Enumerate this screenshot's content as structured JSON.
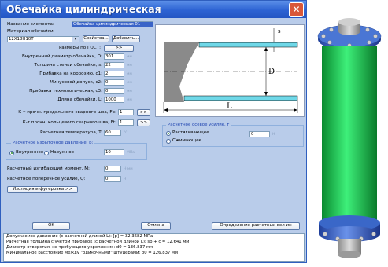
{
  "window": {
    "title": "Обечайка цилиндрическая",
    "close_glyph": "✕"
  },
  "name": {
    "label": "Название элемента:",
    "value": "Обечайка цилиндрическая 01"
  },
  "material": {
    "label": "Материал обечайки:",
    "value": "12Х18Н10Т",
    "props_btn": "Свойства...",
    "add_btn": "Добавить..."
  },
  "gost": {
    "label": "Размеры по ГОСТ:",
    "btn": ">>"
  },
  "fields": [
    {
      "label": "Внутренний диаметр обечайки, D:",
      "value": "301",
      "unit": "мм"
    },
    {
      "label": "Толщина стенки обечайки, s:",
      "value": "22",
      "unit": "мм"
    },
    {
      "label": "Прибавка на коррозию, c1:",
      "value": "2",
      "unit": "мм"
    },
    {
      "label": "Минусовой допуск, c2:",
      "value": "0",
      "unit": "мм"
    },
    {
      "label": "Прибавка технологическая, c3:",
      "value": "0",
      "unit": "мм"
    },
    {
      "label": "Длина обечайки, L:",
      "value": "1000",
      "unit": "мм"
    }
  ],
  "weld_long": {
    "label": "К-т прочн. продольного сварного шва, Fp:",
    "value": "1",
    "btn": ">>"
  },
  "weld_circ": {
    "label": "К-т прочн. кольцевого сварного шва, Ft:",
    "value": "1",
    "btn": ">>"
  },
  "temperature": {
    "label": "Расчетная температура, T:",
    "value": "60",
    "unit": "°C"
  },
  "pressure": {
    "group_label": "Расчетное избыточное давление, p:",
    "inner": "Внутреннее",
    "outer": "Наружное",
    "value": "10",
    "unit": "МПа"
  },
  "moment": {
    "label": "Расчетный изгибающий момент, M:",
    "value": "0",
    "unit": "Н·мм"
  },
  "shear": {
    "label": "Расчетное поперечное усилие, Q:",
    "value": "0",
    "unit": "Н"
  },
  "iso_btn": "Изоляция и футеровка >>",
  "axial": {
    "group_label": "Расчетное осевое усилие, F",
    "tension": "Растягивающее",
    "compress": "Сжимающее",
    "value": "0",
    "unit": "Н"
  },
  "diagram": {
    "s_label": "s",
    "d_label": "D",
    "l_label": "L"
  },
  "buttons": {
    "ok": "OK",
    "cancel": "Отмена",
    "define": "Определение расчетных вел-ин"
  },
  "status_lines": [
    "Допускаемое давление (с расчетной длиной L): [p] = 32.3682 МПа",
    "Расчетная толщина с учётом прибавок (с расчетной длиной L): sp + c = 12.641 мм",
    "Диаметр отверстия, не требующего укрепления: d0 = 136.837 мм",
    "Минимальное расстояние между \"одиночными\" штуцерами: b0 = 126.837 мм"
  ],
  "colors": {
    "title_bar": "#2d63d3",
    "window_bg": "#b9ccea",
    "vessel_body": "#1ed85a",
    "vessel_flange": "#3a67c8"
  }
}
